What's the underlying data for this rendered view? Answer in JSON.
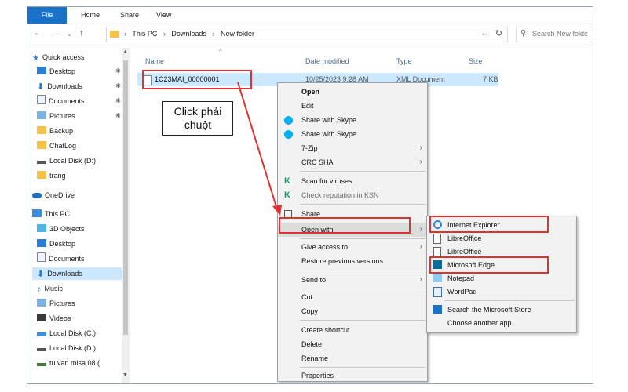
{
  "ribbon": {
    "tabs": [
      "File",
      "Home",
      "Share",
      "View"
    ]
  },
  "address": {
    "crumbs": [
      "This PC",
      "Downloads",
      "New folder"
    ],
    "search_placeholder": "Search New folde"
  },
  "sidebar": {
    "items": [
      {
        "label": "Quick access",
        "icon": "star-icon",
        "pinned": false
      },
      {
        "label": "Desktop",
        "icon": "desktop-icon",
        "pinned": true
      },
      {
        "label": "Downloads",
        "icon": "download-icon",
        "pinned": true
      },
      {
        "label": "Documents",
        "icon": "document-icon",
        "pinned": true
      },
      {
        "label": "Pictures",
        "icon": "pictures-icon",
        "pinned": true
      },
      {
        "label": "Backup",
        "icon": "folder-icon",
        "pinned": false
      },
      {
        "label": "ChatLog",
        "icon": "folder-icon",
        "pinned": false
      },
      {
        "label": "Local Disk (D:)",
        "icon": "drive-icon",
        "pinned": false
      },
      {
        "label": "trang",
        "icon": "folder-icon",
        "pinned": false
      },
      {
        "label": "OneDrive",
        "icon": "cloud-icon",
        "pinned": false
      },
      {
        "label": "This PC",
        "icon": "pc-icon",
        "pinned": false
      },
      {
        "label": "3D Objects",
        "icon": "cube-icon",
        "pinned": false
      },
      {
        "label": "Desktop",
        "icon": "desktop-icon",
        "pinned": false
      },
      {
        "label": "Documents",
        "icon": "document-icon",
        "pinned": false
      },
      {
        "label": "Downloads",
        "icon": "download-icon",
        "pinned": false
      },
      {
        "label": "Music",
        "icon": "music-icon",
        "pinned": false
      },
      {
        "label": "Pictures",
        "icon": "pictures-icon",
        "pinned": false
      },
      {
        "label": "Videos",
        "icon": "video-icon",
        "pinned": false
      },
      {
        "label": "Local Disk (C:)",
        "icon": "drive-icon",
        "pinned": false
      },
      {
        "label": "Local Disk (D:)",
        "icon": "drive-icon",
        "pinned": false
      },
      {
        "label": "tu van misa 08 (",
        "icon": "network-drive-icon",
        "pinned": false
      }
    ]
  },
  "columns": {
    "name": "Name",
    "date": "Date modified",
    "type": "Type",
    "size": "Size"
  },
  "file": {
    "name": "1C23MAI_00000001",
    "date": "10/25/2023 9:28 AM",
    "type": "XML Document",
    "size": "7 KB"
  },
  "context_menu": {
    "items": [
      {
        "label": "Open",
        "bold": true
      },
      {
        "label": "Edit"
      },
      {
        "label": "Share with Skype",
        "icon": "skype-icon"
      },
      {
        "label": "Share with Skype",
        "icon": "skype-icon"
      },
      {
        "label": "7-Zip",
        "submenu": true
      },
      {
        "label": "CRC SHA",
        "submenu": true
      },
      {
        "label": "Scan for viruses",
        "icon": "kaspersky-icon"
      },
      {
        "label": "Check reputation in KSN",
        "icon": "kaspersky-icon",
        "disabled": true
      },
      {
        "label": "Share",
        "icon": "share-icon"
      },
      {
        "label": "Open with",
        "submenu": true,
        "highlighted": true
      },
      {
        "label": "Give access to",
        "submenu": true
      },
      {
        "label": "Restore previous versions"
      },
      {
        "label": "Send to",
        "submenu": true
      },
      {
        "label": "Cut"
      },
      {
        "label": "Copy"
      },
      {
        "label": "Create shortcut"
      },
      {
        "label": "Delete"
      },
      {
        "label": "Rename"
      },
      {
        "label": "Properties"
      }
    ]
  },
  "open_with_menu": {
    "items": [
      {
        "label": "Internet Explorer",
        "icon": "internet-explorer-icon"
      },
      {
        "label": "LibreOffice",
        "icon": "blank-file-icon"
      },
      {
        "label": "LibreOffice",
        "icon": "blank-file-icon"
      },
      {
        "label": "Microsoft Edge",
        "icon": "edge-icon"
      },
      {
        "label": "Notepad",
        "icon": "notepad-icon"
      },
      {
        "label": "WordPad",
        "icon": "wordpad-icon"
      },
      {
        "label": "Search the Microsoft Store",
        "icon": "store-icon"
      },
      {
        "label": "Choose another app"
      }
    ]
  },
  "annotation": {
    "text": "Click phải chuột"
  },
  "colors": {
    "accent": "#1a73c9",
    "selection": "#cce8ff",
    "highlight_box": "#e03030"
  }
}
